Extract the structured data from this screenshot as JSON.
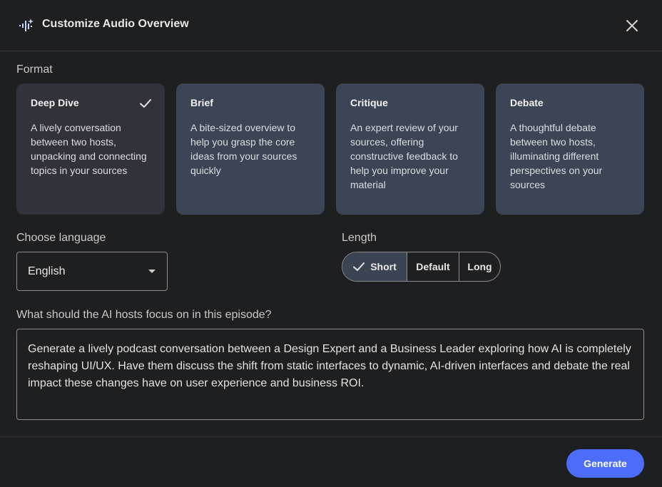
{
  "dialog": {
    "title": "Customize Audio Overview",
    "title_icon": "audio-spark-icon",
    "close_icon": "close-icon"
  },
  "format": {
    "label": "Format",
    "cards": [
      {
        "title": "Deep Dive",
        "description": "A lively conversation between two hosts, unpacking and connecting topics in your sources",
        "selected": true
      },
      {
        "title": "Brief",
        "description": "A bite-sized overview to help you grasp the core ideas from your sources quickly",
        "selected": false
      },
      {
        "title": "Critique",
        "description": "An expert review of your sources, offering constructive feedback to help you improve your material",
        "selected": false
      },
      {
        "title": "Debate",
        "description": "A thoughtful debate between two hosts, illuminating different perspectives on your sources",
        "selected": false
      }
    ]
  },
  "language": {
    "label": "Choose language",
    "selected": "English"
  },
  "length": {
    "label": "Length",
    "options": [
      "Short",
      "Default",
      "Long"
    ],
    "selected": "Short"
  },
  "focus": {
    "label": "What should the AI hosts focus on in this episode?",
    "value": "Generate a lively podcast conversation between a Design Expert and a Business Leader exploring how AI is completely reshaping UI/UX. Have them discuss the shift from static interfaces to dynamic, AI-driven interfaces and debate the real impact these changes have on user experience and business ROI."
  },
  "actions": {
    "generate_label": "Generate"
  },
  "colors": {
    "accent": "#4c6df7",
    "card": "#3c4555",
    "card_selected": "#32333a",
    "background": "#1e1f20"
  }
}
